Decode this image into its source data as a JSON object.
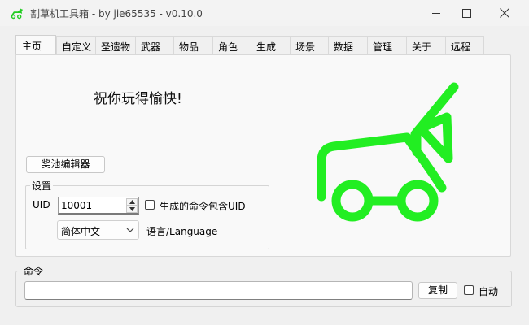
{
  "window": {
    "title": "割草机工具箱  - by jie65535  - v0.10.0",
    "accent_color": "#22ee22"
  },
  "title_controls": {
    "minimize_icon": "minimize-icon",
    "maximize_icon": "maximize-icon",
    "close_icon": "close-icon"
  },
  "tabs": [
    {
      "label": "主页",
      "active": true
    },
    {
      "label": "自定义"
    },
    {
      "label": "圣遗物"
    },
    {
      "label": "武器"
    },
    {
      "label": "物品"
    },
    {
      "label": "角色"
    },
    {
      "label": "生成"
    },
    {
      "label": "场景"
    },
    {
      "label": "数据"
    },
    {
      "label": "管理"
    },
    {
      "label": "关于"
    },
    {
      "label": "远程"
    }
  ],
  "home": {
    "welcome_text": "祝你玩得愉快!",
    "pool_editor_button": "奖池编辑器",
    "settings": {
      "group_title": "设置",
      "uid_label": "UID",
      "uid_value": "10001",
      "include_uid_label": "生成的命令包含UID",
      "include_uid_checked": false,
      "language_value": "简体中文",
      "language_label": "语言/Language"
    },
    "logo_icon": "car-logo-icon"
  },
  "command": {
    "group_title": "命令",
    "input_value": "",
    "copy_button": "复制",
    "auto_label": "自动",
    "auto_checked": false
  }
}
